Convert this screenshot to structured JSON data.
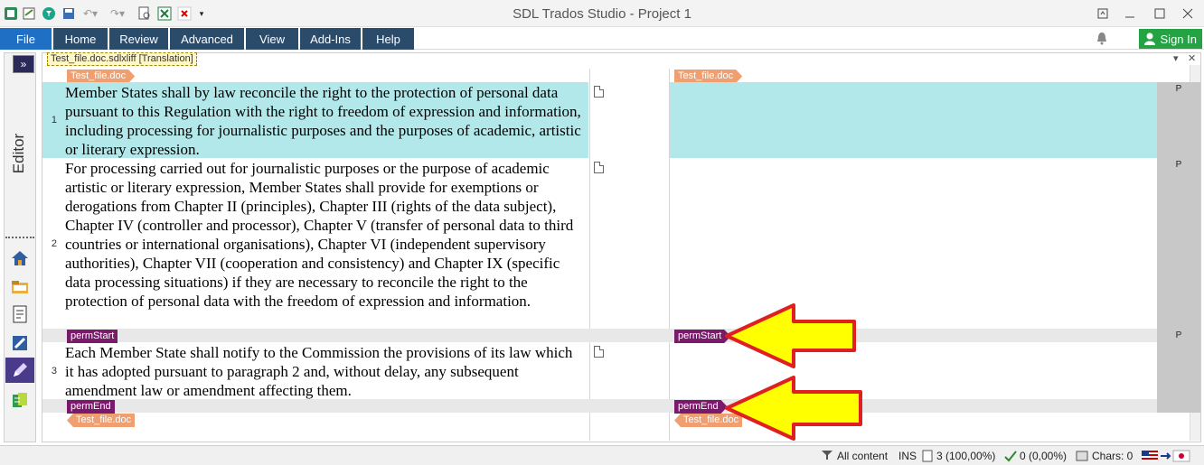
{
  "window": {
    "title": "SDL Trados Studio - Project 1"
  },
  "menu": {
    "tabs": [
      "File",
      "Home",
      "Review",
      "Advanced",
      "View",
      "Add-Ins",
      "Help"
    ],
    "signin": "Sign In"
  },
  "sidebar": {
    "label": "Editor",
    "expand": "»"
  },
  "document": {
    "tab_title": "Test_file.doc.sdlxliff [Translation]",
    "file_tag": "Test_file.doc"
  },
  "segments": [
    {
      "id": "1",
      "source": "Member States shall by law reconcile the right to the protection of personal data pursuant to this Regulation with the right to freedom of expression and information, including processing for journalistic purposes and the purposes of academic, artistic or literary expression.",
      "status": "P"
    },
    {
      "id": "2",
      "source": "For processing carried out for journalistic purposes or the purpose of academic artistic or literary expression, Member States shall provide for exemptions or derogations from Chapter II (principles), Chapter III (rights of the data subject), Chapter IV (controller and processor), Chapter V (transfer of personal data to third countries or international organisations), Chapter VI (independent supervisory authorities), Chapter VII (cooperation and consistency) and Chapter IX (specific data processing situations) if they are necessary to reconcile the right to the protection of personal data with the freedom of expression and information.",
      "status": "P"
    },
    {
      "id": "3",
      "source": "Each Member State shall notify to the Commission the provisions of its law which it has adopted pursuant to paragraph 2 and, without delay, any subsequent amendment law or amendment affecting them.",
      "status": "P"
    }
  ],
  "tags": {
    "perm_start": "permStart",
    "perm_end": "permEnd"
  },
  "statusbar": {
    "filter": "All content",
    "mode": "INS",
    "segments_count": "3 (100,00%)",
    "confirmed": "0 (0,00%)",
    "chars": "Chars: 0"
  },
  "colors": {
    "active_row": "#b2e8ea",
    "file_tag": "#f0a070",
    "perm_tag": "#7a1a6a",
    "arrow_fill": "#ffff00",
    "arrow_stroke": "#e02020"
  }
}
